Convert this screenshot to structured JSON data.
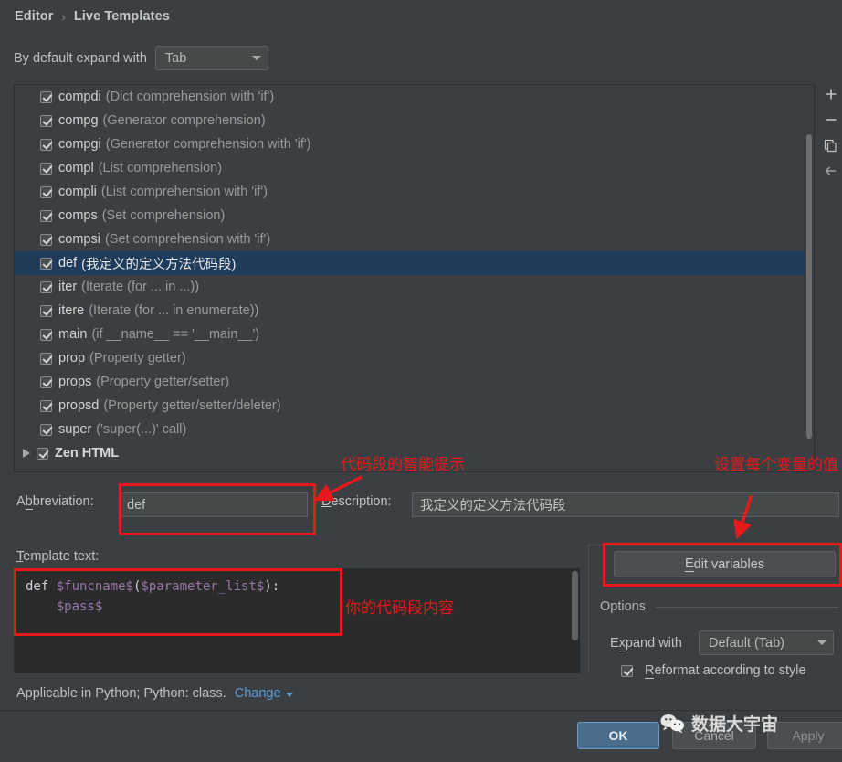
{
  "breadcrumb": {
    "parent": "Editor",
    "separator": "›",
    "current": "Live Templates"
  },
  "expand_default": {
    "label": "By default expand with",
    "combo_value": "Tab",
    "combo_name": "expandwith-combo"
  },
  "list_toolbar": [
    {
      "name": "add-icon",
      "title": "+"
    },
    {
      "name": "remove-icon",
      "title": "−"
    },
    {
      "name": "duplicate-icon",
      "title": "copy"
    },
    {
      "name": "revert-icon",
      "title": "←"
    }
  ],
  "templates": [
    {
      "abbrev": "compdi",
      "desc": "(Dict comprehension with 'if')",
      "checked": true,
      "selected": false,
      "group": false
    },
    {
      "abbrev": "compg",
      "desc": "(Generator comprehension)",
      "checked": true,
      "selected": false,
      "group": false
    },
    {
      "abbrev": "compgi",
      "desc": "(Generator comprehension with 'if')",
      "checked": true,
      "selected": false,
      "group": false
    },
    {
      "abbrev": "compl",
      "desc": "(List comprehension)",
      "checked": true,
      "selected": false,
      "group": false
    },
    {
      "abbrev": "compli",
      "desc": "(List comprehension with 'if')",
      "checked": true,
      "selected": false,
      "group": false
    },
    {
      "abbrev": "comps",
      "desc": "(Set comprehension)",
      "checked": true,
      "selected": false,
      "group": false
    },
    {
      "abbrev": "compsi",
      "desc": "(Set comprehension with 'if')",
      "checked": true,
      "selected": false,
      "group": false
    },
    {
      "abbrev": "def",
      "desc": "(我定义的定义方法代码段)",
      "checked": true,
      "selected": true,
      "group": false
    },
    {
      "abbrev": "iter",
      "desc": "(Iterate (for ... in ...))",
      "checked": true,
      "selected": false,
      "group": false
    },
    {
      "abbrev": "itere",
      "desc": "(Iterate (for ... in enumerate))",
      "checked": true,
      "selected": false,
      "group": false
    },
    {
      "abbrev": "main",
      "desc": "(if __name__ == '__main__')",
      "checked": true,
      "selected": false,
      "group": false
    },
    {
      "abbrev": "prop",
      "desc": "(Property getter)",
      "checked": true,
      "selected": false,
      "group": false
    },
    {
      "abbrev": "props",
      "desc": "(Property getter/setter)",
      "checked": true,
      "selected": false,
      "group": false
    },
    {
      "abbrev": "propsd",
      "desc": "(Property getter/setter/deleter)",
      "checked": true,
      "selected": false,
      "group": false
    },
    {
      "abbrev": "super",
      "desc": "('super(...)' call)",
      "checked": true,
      "selected": false,
      "group": false
    },
    {
      "abbrev": "Zen HTML",
      "desc": "",
      "checked": true,
      "selected": false,
      "group": true
    }
  ],
  "abbreviation": {
    "label": "Abbreviation:",
    "mnemonic": "b",
    "value": "def"
  },
  "description": {
    "label": "Description:",
    "mnemonic": "D",
    "value": "我定义的定义方法代码段"
  },
  "template_text": {
    "label": "Template text:",
    "line1_kw": "def ",
    "line1_var1": "$funcname$",
    "line1_mid": "(",
    "line1_var2": "$parameter_list$",
    "line1_end": "):",
    "line2_indent": "    ",
    "line2_var": "$pass$"
  },
  "applicable": {
    "text": "Applicable in Python; Python: class.",
    "change_label": "Change"
  },
  "right_panel": {
    "edit_variables_label": "Edit variables",
    "edit_variables_mnemonic": "E",
    "options_title": "Options",
    "expand_with_label": "Expand with",
    "expand_with_mnemonic": "x",
    "expand_with_value": "Default (Tab)",
    "reformat_label": "Reformat according to style",
    "reformat_mnemonic": "R",
    "reformat_checked": true
  },
  "buttons": {
    "ok": "OK",
    "cancel": "Cancel",
    "apply": "Apply"
  },
  "watermark": {
    "text": "数据大宇宙"
  },
  "annotations": {
    "hint": "代码段的智能提示",
    "variables": "设置每个变量的值",
    "code": "你的代码段内容"
  },
  "colors": {
    "window_bg": "#3c3f41",
    "selection": "#1f3c5a",
    "annotation_red": "#e8191a",
    "link_blue": "#5b9bd5",
    "ok_blue": "#4a6d8c",
    "code_bg": "#2b2b2b",
    "variable_purple": "#9876aa"
  }
}
